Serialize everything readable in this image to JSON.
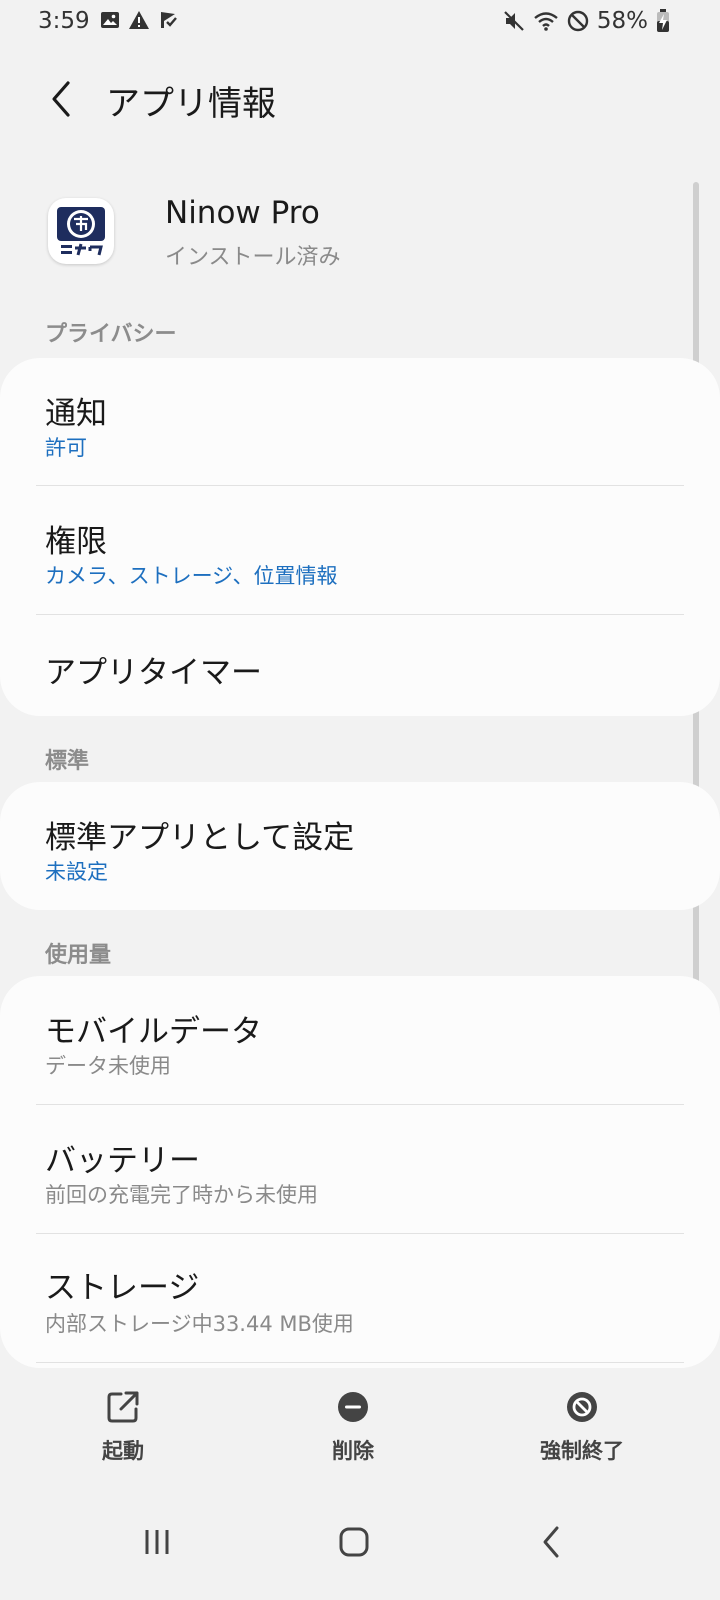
{
  "status_bar": {
    "time": "3:59",
    "battery_percent": "58%",
    "left_icons": [
      "image-icon",
      "alert-triangle-icon",
      "download-flag-icon"
    ],
    "right_icons": [
      "mute-icon",
      "wifi-icon",
      "do-not-disturb-icon",
      "battery-charging-icon"
    ]
  },
  "header": {
    "title": "アプリ情報",
    "back_icon": "chevron-left-icon"
  },
  "app": {
    "name": "Ninow Pro",
    "status": "インストール済み",
    "icon": "ninow-app-icon"
  },
  "sections": {
    "privacy": {
      "header": "プライバシー",
      "notifications": {
        "title": "通知",
        "value": "許可"
      },
      "permissions": {
        "title": "権限",
        "value": "カメラ、ストレージ、位置情報"
      },
      "app_timer": {
        "title": "アプリタイマー"
      }
    },
    "defaults": {
      "header": "標準",
      "set_default": {
        "title": "標準アプリとして設定",
        "value": "未設定"
      }
    },
    "usage": {
      "header": "使用量",
      "mobile_data": {
        "title": "モバイルデータ",
        "value": "データ未使用"
      },
      "battery": {
        "title": "バッテリー",
        "value": "前回の充電完了時から未使用"
      },
      "storage": {
        "title": "ストレージ",
        "value": "内部ストレージ中33.44 MB使用"
      }
    }
  },
  "actions": {
    "open": {
      "label": "起動",
      "icon": "open-external-icon"
    },
    "uninstall": {
      "label": "削除",
      "icon": "remove-circle-icon"
    },
    "force_stop": {
      "label": "強制終了",
      "icon": "stop-circle-icon"
    }
  },
  "nav": {
    "recents_icon": "recents-icon",
    "home_icon": "home-icon",
    "back_icon": "back-icon"
  },
  "colors": {
    "background": "#f2f2f2",
    "card": "#fcfcfc",
    "accent_blue": "#1d6fbf",
    "secondary_text": "#8a8a8a",
    "section_header": "#8c8c8c"
  }
}
